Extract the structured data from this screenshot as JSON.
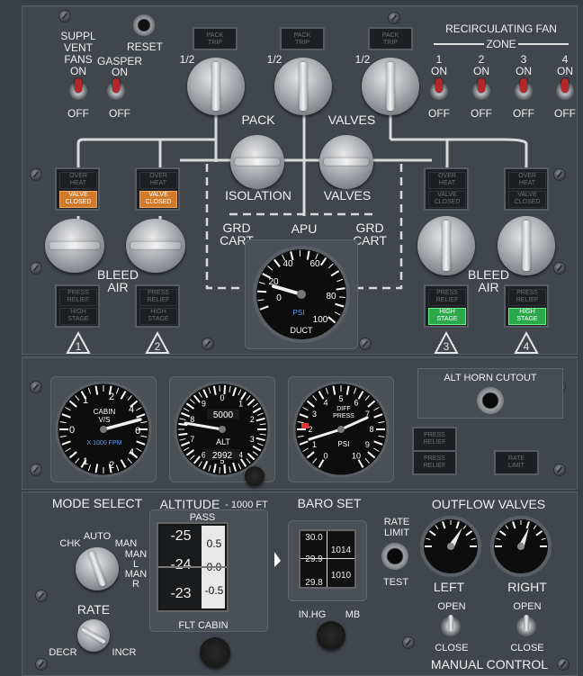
{
  "upper": {
    "suppl_vent_fans": [
      "SUPPL",
      "VENT",
      "FANS"
    ],
    "on": "ON",
    "off": "OFF",
    "reset": "RESET",
    "gasper": "GASPER",
    "pack_trip": [
      "PACK",
      "TRIP"
    ],
    "half": "1/2",
    "recirc_title": "RECIRCULATING FAN",
    "zone": "ZONE",
    "zones": [
      "1",
      "2",
      "3",
      "4"
    ],
    "pack": "PACK",
    "valves": "VALVES",
    "isolation": "ISOLATION",
    "grd_cart": [
      "GRD",
      "CART"
    ],
    "apu": "APU",
    "bleed_air": [
      "BLEED",
      "AIR"
    ],
    "over_heat": [
      "OVER",
      "HEAT"
    ],
    "valve_closed": [
      "VALVE",
      "CLOSED"
    ],
    "press_relief": [
      "PRESS",
      "RELIEF"
    ],
    "high_stage": [
      "HIGH",
      "STAGE"
    ],
    "engines": [
      "1",
      "2",
      "3",
      "4"
    ],
    "duct_gauge": {
      "ticks": [
        "20",
        "40",
        "60",
        "80",
        "100"
      ],
      "zero": "0",
      "unit": "PSI",
      "label": "DUCT",
      "value": 24
    }
  },
  "middle": {
    "alt_horn_cutout": "ALT HORN CUTOUT",
    "rate_limit": [
      "RATE",
      "LIMIT"
    ],
    "cabin_vs": {
      "label": [
        "CABIN",
        "V/S"
      ],
      "unit": "X 1000 FPM",
      "ticks": [
        "0",
        "1",
        "2",
        "4",
        "6",
        "4",
        "2",
        "1"
      ]
    },
    "alt_gauge": {
      "label": "ALT",
      "counter": "5000",
      "baro": "2992",
      "ticks": [
        "0",
        "1",
        "2",
        "3",
        "4",
        "5",
        "6",
        "7",
        "8",
        "9"
      ]
    },
    "diff_press": {
      "label": [
        "DIFF",
        "PRESS"
      ],
      "unit": "PSI",
      "ticks": [
        "0",
        "1",
        "2",
        "3",
        "4",
        "5",
        "6",
        "7",
        "8",
        "9",
        "10"
      ]
    }
  },
  "lower": {
    "mode_select": "MODE SELECT",
    "chk": "CHK",
    "auto": "AUTO",
    "man": "MAN",
    "man_l": [
      "MAN",
      "L"
    ],
    "man_r": [
      "MAN",
      "R"
    ],
    "rate": "RATE",
    "decr": "DECR",
    "incr": "INCR",
    "altitude": "ALTITUDE",
    "altitude_unit": "- 1000 FT",
    "pass": "PASS",
    "flt_cabin": "FLT CABIN",
    "tape_left": [
      "-25",
      "-24",
      "-23"
    ],
    "tape_right": [
      "0.5",
      "0.0",
      "-0.5"
    ],
    "baro_set": "BARO SET",
    "baro_left": [
      "30.0",
      "29.9",
      "29.8"
    ],
    "baro_right": [
      "1014",
      "1010"
    ],
    "in_hg": "IN.HG",
    "mb": "MB",
    "rate_limit": [
      "RATE",
      "LIMIT"
    ],
    "test": "TEST",
    "outflow_valves": "OUTFLOW VALVES",
    "left": "LEFT",
    "right": "RIGHT",
    "open": "OPEN",
    "close": "CLOSE",
    "manual_control": "MANUAL CONTROL"
  }
}
